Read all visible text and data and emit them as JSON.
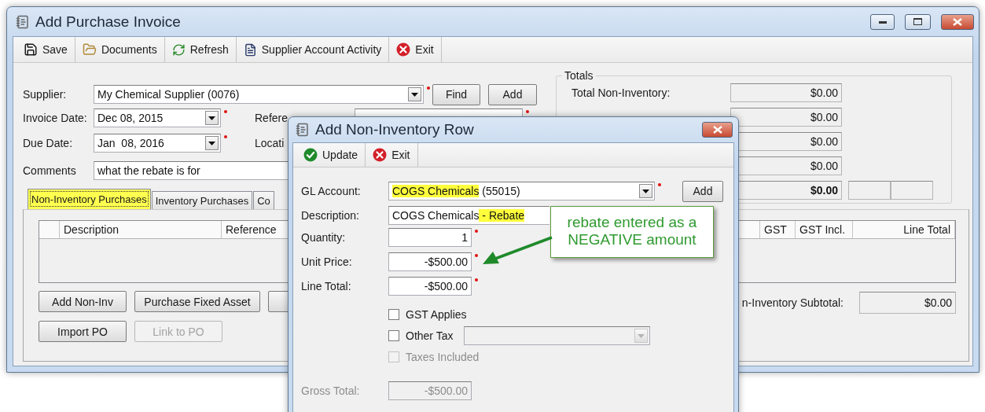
{
  "main": {
    "title": "Add Purchase Invoice",
    "toolbar": [
      {
        "label": "Save",
        "kind": "save"
      },
      {
        "label": "Documents",
        "kind": "documents"
      },
      {
        "label": "Refresh",
        "kind": "refresh"
      },
      {
        "label": "Supplier Account Activity",
        "kind": "activity"
      },
      {
        "label": "Exit",
        "kind": "exit"
      }
    ],
    "supplier": {
      "label": "Supplier:",
      "value": "My Chemical Supplier (0076)",
      "required": true
    },
    "find_button": "Find",
    "add_button": "Add",
    "invoice_date": {
      "label": "Invoice Date:",
      "value": "Dec 08, 2015",
      "required": true
    },
    "reference": {
      "label": "Refere",
      "required": true
    },
    "due_date": {
      "label": "Due Date:",
      "value": "Jan  08, 2016",
      "required": true
    },
    "location": {
      "label": "Locati"
    },
    "comments": {
      "label": "Comments",
      "value": "what the rebate is for"
    },
    "totals": {
      "title": "Totals",
      "rows": [
        {
          "label": "Total Non-Inventory:",
          "value": "$0.00",
          "bold": false
        },
        {
          "value": "$0.00",
          "bold": false
        },
        {
          "value": "$0.00",
          "bold": false
        },
        {
          "value": "$0.00",
          "bold": false
        },
        {
          "value": "$0.00",
          "bold": true
        }
      ]
    },
    "tabs": [
      {
        "label": "Non-Inventory Purchases",
        "selected": true,
        "highlighted": true
      },
      {
        "label": "Inventory Purchases",
        "selected": false,
        "highlighted": false
      },
      {
        "label": "Co",
        "selected": false,
        "highlighted": false
      }
    ],
    "columns": [
      {
        "label": "Description"
      },
      {
        "label": "Reference"
      },
      {
        "label": "GST"
      },
      {
        "label": "GST Incl."
      },
      {
        "label": "Line Total"
      }
    ],
    "button_rows": [
      [
        {
          "label": "Add Non-Inv",
          "disabled": false
        },
        {
          "label": "Purchase Fixed Asset",
          "disabled": false
        }
      ],
      [
        {
          "label": "Import PO",
          "disabled": false
        },
        {
          "label": "Link to PO",
          "disabled": true
        }
      ]
    ],
    "subtotal": {
      "label": "n-Inventory Subtotal:",
      "value": "$0.00"
    }
  },
  "dialog": {
    "title": "Add Non-Inventory Row",
    "toolbar": [
      {
        "label": "Update",
        "kind": "check"
      },
      {
        "label": "Exit",
        "kind": "exit"
      }
    ],
    "gl_account": {
      "label": "GL Account:",
      "parts": [
        {
          "text": "COGS Chemicals",
          "highlighted": true
        },
        {
          "text": " (55015)",
          "highlighted": false
        }
      ],
      "required": true
    },
    "add_button": "Add",
    "description": {
      "label": "Description:",
      "parts": [
        {
          "text": "COGS Chemicals",
          "highlighted": false
        },
        {
          "text": " - Rebate",
          "highlighted": true
        }
      ]
    },
    "amounts": [
      {
        "label": "Quantity:",
        "value": "1",
        "required": true
      },
      {
        "label": "Unit Price:",
        "value": "-$500.00",
        "required": true
      },
      {
        "label": "Line Total:",
        "value": "-$500.00",
        "required": true
      }
    ],
    "checks": [
      {
        "label": "GST Applies",
        "checked": false,
        "disabled": false,
        "kind": "plain"
      },
      {
        "label": "Other Tax",
        "checked": false,
        "disabled": false,
        "kind": "select"
      },
      {
        "label": "Taxes Included",
        "checked": false,
        "disabled": true,
        "kind": "plain"
      }
    ],
    "gross_total": {
      "label": "Gross Total:",
      "value": "-$500.00",
      "disabled": true
    }
  },
  "callout": {
    "text": "rebate entered as a NEGATIVE amount"
  }
}
